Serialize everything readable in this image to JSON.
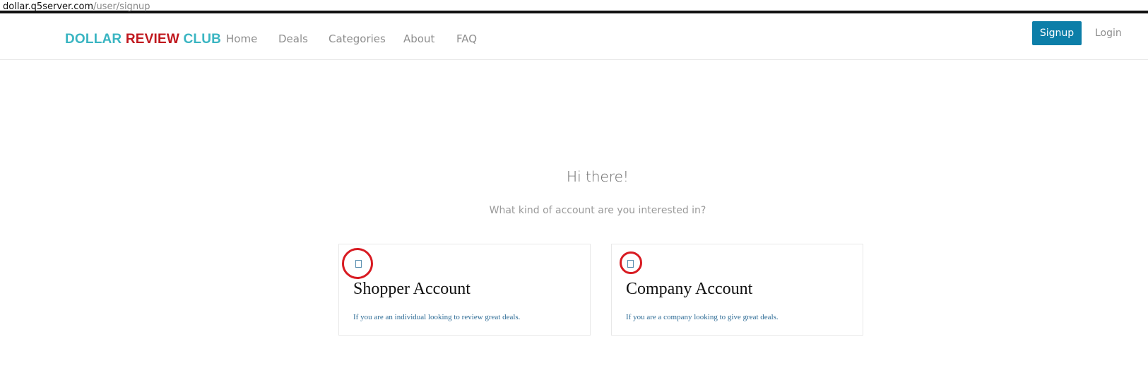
{
  "browser": {
    "url_host": "dollar.q5server.com",
    "url_path": "/user/signup"
  },
  "brand": {
    "word1": "DOLLAR",
    "word2": "REVIEW",
    "word3": "CLUB",
    "color_primary": "#3ab5c2",
    "color_accent": "#c0181e"
  },
  "nav": {
    "items": [
      {
        "label": "Home"
      },
      {
        "label": "Deals"
      },
      {
        "label": "Categories"
      },
      {
        "label": "About"
      },
      {
        "label": "FAQ"
      }
    ],
    "signup_label": "Signup",
    "login_label": "Login",
    "signup_color": "#0c7ea8"
  },
  "main": {
    "greeting": "Hi there!",
    "question": "What kind of account are you interested in?",
    "cards": [
      {
        "icon": "missing-glyph-icon",
        "title": "Shopper Account",
        "description": "If you are an individual looking to review great deals."
      },
      {
        "icon": "missing-glyph-icon",
        "title": "Company Account",
        "description": "If you are a company looking to give great deals."
      }
    ]
  },
  "annotation_color": "#d81b22"
}
